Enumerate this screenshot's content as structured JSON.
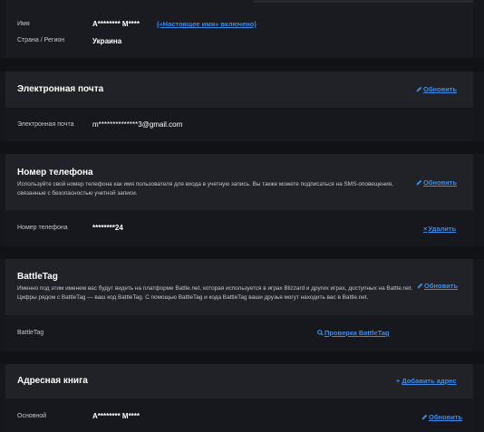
{
  "identity": {
    "name_label": "Имя",
    "name_value": "А******** М****",
    "real_name_link": "(«Настоящее имя» включено)",
    "country_label": "Страна / Регион",
    "country_value": "Украина"
  },
  "email": {
    "title": "Электронная почта",
    "update_label": "Обновить",
    "field_label": "Электронная почта",
    "field_value": "m**************3@gmail.com"
  },
  "phone": {
    "title": "Номер телефона",
    "description": "Используйте свой номер телефона как имя пользователя для входа в учетную запись. Вы также можете подписаться на SMS-оповещения, связанные с безопасностью учетной записи.",
    "update_label": "Обновить",
    "field_label": "Номер телефона",
    "field_value": "********24",
    "remove_label": "Удалить"
  },
  "battletag": {
    "title": "BattleTag",
    "description": "Именно под этим именем вас будут видеть на платформе Battle.net, которая используется в играх Blizzard и других играх, доступных на Battle.net. Цифры рядом с BattleTag — ваш код BattleTag. С помощью BattleTag и кода BattleTag ваши друзья могут находить вас в Battle.net.",
    "update_label": "Обновить",
    "field_label": "BattleTag",
    "check_label": "Проверка BattleTag"
  },
  "address_book": {
    "title": "Адресная книга",
    "add_label": "Добавить адрес",
    "field_label": "Основной",
    "field_value": "А******** М****",
    "update_label": "Обновить"
  },
  "colors": {
    "accent": "#3b8ce6",
    "panel": "#202227",
    "row": "#17181d",
    "background": "#111216"
  }
}
